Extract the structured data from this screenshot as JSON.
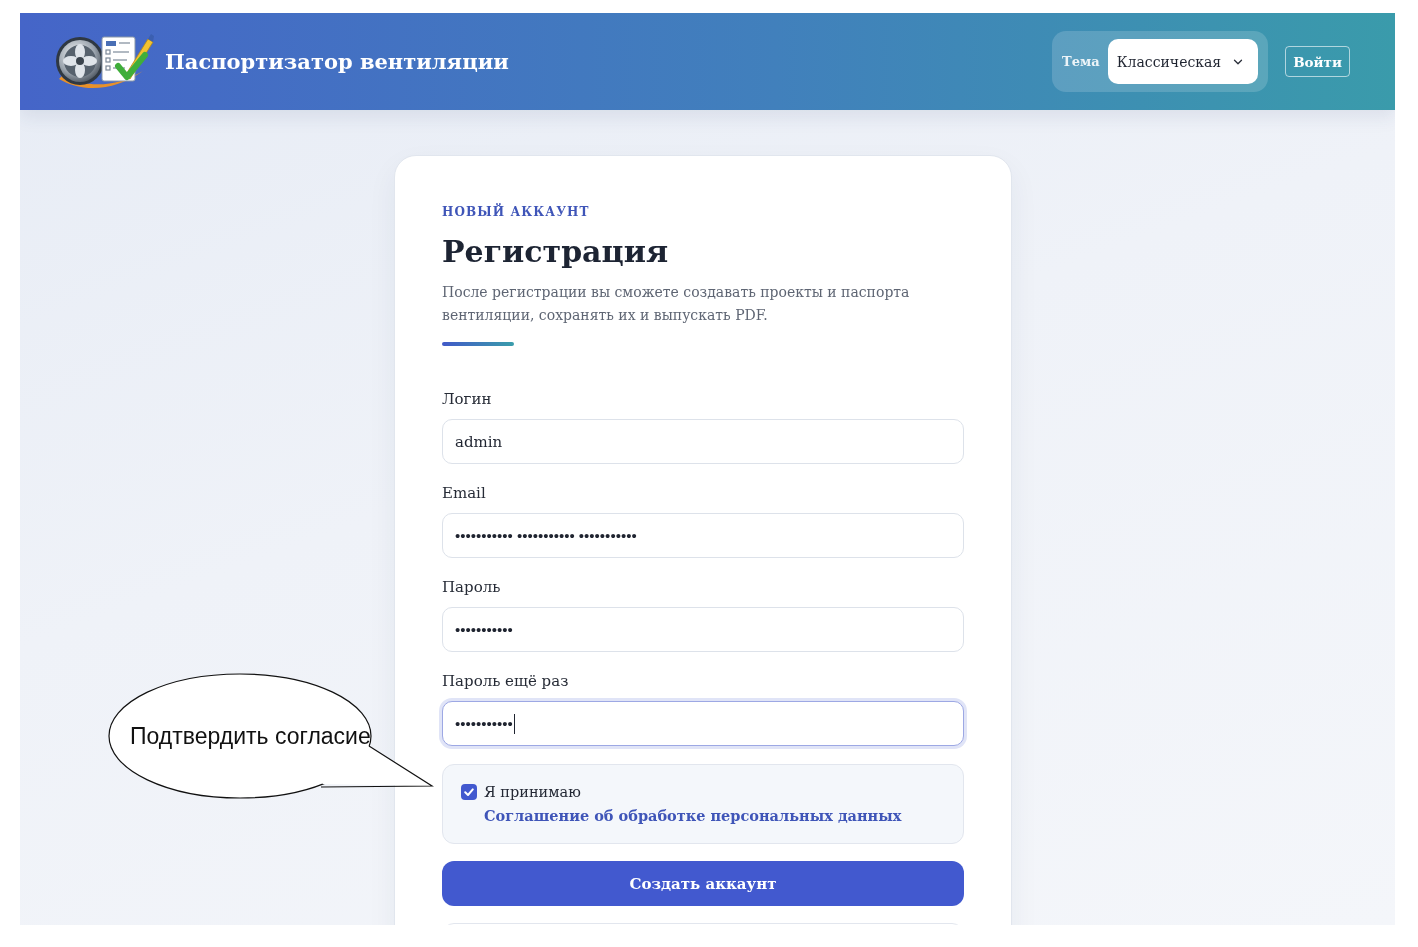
{
  "header": {
    "title": "Паспортизатор вентиляции",
    "theme_picker": {
      "label": "Тема",
      "value": "Классическая"
    },
    "login_button": "Войти"
  },
  "registration_form": {
    "eyebrow": "НОВЫЙ АККАУНТ",
    "title": "Регистрация",
    "description": "После регистрации вы сможете создавать проекты и паспорта вентиляции, сохранять их и выпускать PDF.",
    "fields": [
      {
        "label": "Логин",
        "value": "admin",
        "masked": false,
        "focused": false
      },
      {
        "label": "Email",
        "value": "••••••••••• ••••••••••• •••••••••••",
        "masked": true,
        "focused": false
      },
      {
        "label": "Пароль",
        "value": "•••••••••••",
        "masked": true,
        "focused": false
      },
      {
        "label": "Пароль ещё раз",
        "value": "•••••••••••",
        "masked": true,
        "focused": true
      }
    ],
    "consent": {
      "checked": true,
      "text": "Я принимаю",
      "link": "Соглашение об обработке персональных данных"
    },
    "submit_button": "Создать аккаунт"
  },
  "callout": {
    "text": "Подтвердить согласие"
  }
}
